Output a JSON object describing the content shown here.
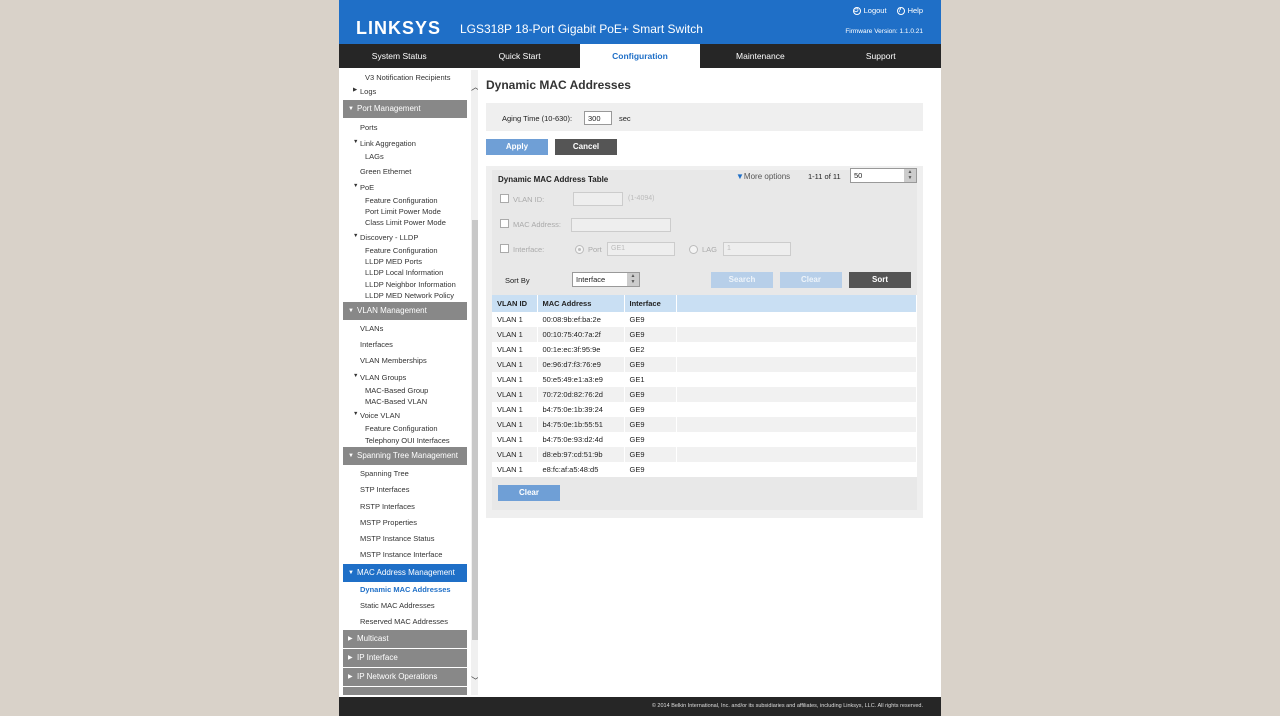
{
  "header": {
    "brand": "LINKSYS",
    "product": "LGS318P 18-Port Gigabit PoE+ Smart Switch",
    "logout": "Logout",
    "help": "Help",
    "firmware": "Firmware Version: 1.1.0.21"
  },
  "tabs": [
    "System Status",
    "Quick Start",
    "Configuration",
    "Maintenance",
    "Support"
  ],
  "active_tab": "Configuration",
  "sidebar": {
    "v3_notification": "V3 Notification Recipients",
    "logs": "Logs",
    "port_management": "Port Management",
    "ports": "Ports",
    "link_aggregation": "Link Aggregation",
    "lags": "LAGs",
    "green_ethernet": "Green Ethernet",
    "poe": "PoE",
    "poe_feature_configuration": "Feature Configuration",
    "port_limit_power_mode": "Port Limit Power Mode",
    "class_limit_power_mode": "Class Limit Power Mode",
    "discovery_lldp": "Discovery - LLDP",
    "lldp_feature_configuration": "Feature Configuration",
    "lldp_med_ports": "LLDP MED Ports",
    "lldp_local_information": "LLDP Local Information",
    "lldp_neighbor_information": "LLDP Neighbor Information",
    "lldp_med_network_policy": "LLDP MED Network Policy",
    "vlan_management": "VLAN Management",
    "vlans": "VLANs",
    "interfaces": "Interfaces",
    "vlan_memberships": "VLAN Memberships",
    "vlan_groups": "VLAN Groups",
    "mac_based_group": "MAC-Based Group",
    "mac_based_vlan": "MAC-Based VLAN",
    "voice_vlan": "Voice VLAN",
    "voice_feature_configuration": "Feature Configuration",
    "telephony_oui_interfaces": "Telephony OUI Interfaces",
    "spanning_tree_management": "Spanning Tree Management",
    "spanning_tree": "Spanning Tree",
    "stp_interfaces": "STP Interfaces",
    "rstp_interfaces": "RSTP Interfaces",
    "mstp_properties": "MSTP Properties",
    "mstp_instance_status": "MSTP Instance Status",
    "mstp_instance_interface": "MSTP Instance Interface",
    "mac_address_management": "MAC Address Management",
    "dynamic_mac_addresses": "Dynamic MAC Addresses",
    "static_mac_addresses": "Static MAC Addresses",
    "reserved_mac_addresses": "Reserved MAC Addresses",
    "multicast": "Multicast",
    "ip_interface": "IP Interface",
    "ip_network_operations": "IP Network Operations"
  },
  "main": {
    "title": "Dynamic MAC Addresses",
    "aging_label": "Aging Time (10-630):",
    "aging_value": "300",
    "aging_unit": "sec",
    "apply": "Apply",
    "cancel": "Cancel",
    "table_title": "Dynamic MAC Address Table",
    "more_options": "More options",
    "pager": "1-11 of 11",
    "per_page": "50",
    "filter": {
      "vlan_id": "VLAN ID:",
      "vlan_hint": "(1-4094)",
      "mac_address": "MAC Address:",
      "interface": "Interface:",
      "port": "Port",
      "port_value": "GE1",
      "lag": "LAG",
      "lag_value": "1"
    },
    "sort_by": "Sort By",
    "sort_value": "Interface",
    "search": "Search",
    "clear": "Clear",
    "sort": "Sort",
    "columns": [
      "VLAN ID",
      "MAC Address",
      "Interface"
    ],
    "rows": [
      [
        "VLAN 1",
        "00:08:9b:ef:ba:2e",
        "GE9"
      ],
      [
        "VLAN 1",
        "00:10:75:40:7a:2f",
        "GE9"
      ],
      [
        "VLAN 1",
        "00:1e:ec:3f:95:9e",
        "GE2"
      ],
      [
        "VLAN 1",
        "0e:96:d7:f3:76:e9",
        "GE9"
      ],
      [
        "VLAN 1",
        "50:e5:49:e1:a3:e9",
        "GE1"
      ],
      [
        "VLAN 1",
        "70:72:0d:82:76:2d",
        "GE9"
      ],
      [
        "VLAN 1",
        "b4:75:0e:1b:39:24",
        "GE9"
      ],
      [
        "VLAN 1",
        "b4:75:0e:1b:55:51",
        "GE9"
      ],
      [
        "VLAN 1",
        "b4:75:0e:93:d2:4d",
        "GE9"
      ],
      [
        "VLAN 1",
        "d8:eb:97:cd:51:9b",
        "GE9"
      ],
      [
        "VLAN 1",
        "e8:fc:af:a5:48:d5",
        "GE9"
      ]
    ],
    "clear_table": "Clear"
  },
  "footer": "© 2014 Belkin International, Inc. and/or its subsidiaries and affiliates, including Linksys, LLC. All rights reserved."
}
